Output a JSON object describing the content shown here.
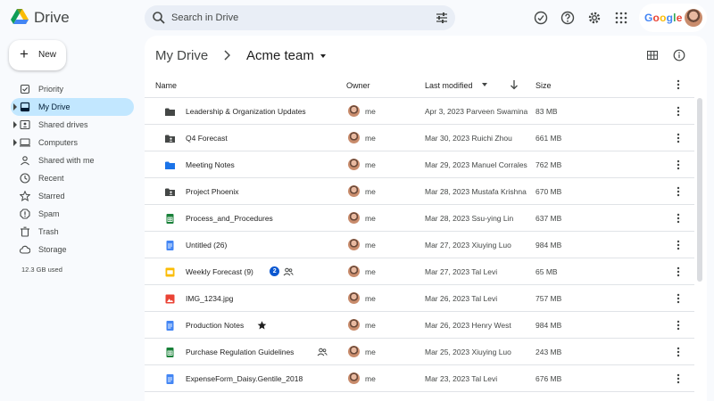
{
  "app": {
    "name": "Drive"
  },
  "search": {
    "placeholder": "Search in Drive"
  },
  "account": {
    "brand": "Google"
  },
  "new_button": {
    "label": "New"
  },
  "nav": {
    "items": [
      {
        "label": "Priority",
        "icon": "priority-icon",
        "caret": false,
        "active": false
      },
      {
        "label": "My Drive",
        "icon": "my-drive-icon",
        "caret": true,
        "active": true
      },
      {
        "label": "Shared drives",
        "icon": "shared-drives-icon",
        "caret": true,
        "active": false
      },
      {
        "label": "Computers",
        "icon": "computer-icon",
        "caret": true,
        "active": false
      },
      {
        "label": "Shared with me",
        "icon": "shared-with-me-icon",
        "caret": false,
        "active": false
      },
      {
        "label": "Recent",
        "icon": "clock-icon",
        "caret": false,
        "active": false
      },
      {
        "label": "Starred",
        "icon": "star-icon",
        "caret": false,
        "active": false
      },
      {
        "label": "Spam",
        "icon": "spam-icon",
        "caret": false,
        "active": false
      },
      {
        "label": "Trash",
        "icon": "trash-icon",
        "caret": false,
        "active": false
      },
      {
        "label": "Storage",
        "icon": "cloud-icon",
        "caret": false,
        "active": false
      }
    ],
    "storage_used": "12.3 GB used"
  },
  "breadcrumb": {
    "root": "My Drive",
    "current": "Acme team"
  },
  "table": {
    "headers": {
      "name": "Name",
      "owner": "Owner",
      "modified": "Last modified",
      "size": "Size"
    },
    "rows": [
      {
        "name": "Leadership & Organization Updates",
        "type": "folder",
        "owner": "me",
        "modified": "Apr 3, 2023 Parveen Swamina",
        "size": "83 MB"
      },
      {
        "name": "Q4 Forecast",
        "type": "shared-folder",
        "owner": "me",
        "modified": "Mar 30, 2023 Ruichi Zhou",
        "size": "661 MB"
      },
      {
        "name": "Meeting Notes",
        "type": "blue-folder",
        "owner": "me",
        "modified": "Mar 29, 2023 Manuel Corrales",
        "size": "762 MB"
      },
      {
        "name": "Project Phoenix",
        "type": "shared-folder",
        "owner": "me",
        "modified": "Mar 28, 2023 Mustafa Krishna",
        "size": "670 MB"
      },
      {
        "name": "Process_and_Procedures",
        "type": "sheet",
        "owner": "me",
        "modified": "Mar 28, 2023 Ssu-ying Lin",
        "size": "637 MB"
      },
      {
        "name": "Untitled (26)",
        "type": "doc",
        "owner": "me",
        "modified": "Mar 27, 2023 Xiuying Luo",
        "size": "984 MB"
      },
      {
        "name": "Weekly Forecast (9)",
        "type": "slides",
        "badge": "2",
        "shared": true,
        "owner": "me",
        "modified": "Mar 27, 2023 Tal Levi",
        "size": "65 MB"
      },
      {
        "name": "IMG_1234.jpg",
        "type": "image",
        "owner": "me",
        "modified": "Mar 26, 2023 Tal Levi",
        "size": "757 MB"
      },
      {
        "name": "Production Notes",
        "type": "doc",
        "starred": true,
        "owner": "me",
        "modified": "Mar 26, 2023 Henry West",
        "size": "984 MB"
      },
      {
        "name": "Purchase Regulation Guidelines",
        "type": "sheet",
        "shared": true,
        "owner": "me",
        "modified": "Mar 25, 2023 Xiuying Luo",
        "size": "243 MB"
      },
      {
        "name": "ExpenseForm_Daisy.Gentile_2018",
        "type": "doc",
        "owner": "me",
        "modified": "Mar 23, 2023 Tal Levi",
        "size": "676 MB"
      }
    ]
  },
  "colors": {
    "folder": "#444746",
    "blue_folder": "#1a73e8",
    "sheet": "#188038",
    "doc": "#4285f4",
    "slides": "#fbbc04",
    "image": "#ea4335",
    "active_nav": "#c2e7ff"
  }
}
